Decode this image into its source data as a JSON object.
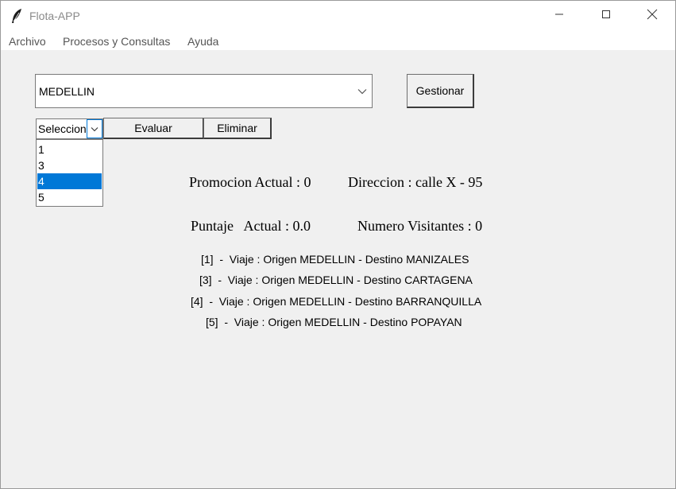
{
  "window": {
    "title": "Flota-APP",
    "icons": {
      "app": "feather-icon",
      "minimize": "minimize-icon",
      "maximize": "maximize-icon",
      "close": "close-icon"
    }
  },
  "menu": {
    "items": [
      "Archivo",
      "Procesos y Consultas",
      "Ayuda"
    ]
  },
  "form": {
    "city_value": "MEDELLIN",
    "gestionar_label": "Gestionar",
    "selector_value": "Seleccione",
    "evaluar_label": "Evaluar",
    "eliminar_label": "Eliminar",
    "dropdown_options": [
      "1",
      "3",
      "4",
      "5"
    ],
    "dropdown_selected": "4"
  },
  "info": {
    "promocion": "Promocion Actual : 0",
    "direccion": "Direccion : calle X - 95",
    "puntaje": "Puntaje   Actual : 0.0",
    "visitantes": "Numero Visitantes : 0"
  },
  "viajes": [
    "[1]  -  Viaje : Origen MEDELLIN - Destino MANIZALES",
    "[3]  -  Viaje : Origen MEDELLIN - Destino CARTAGENA",
    "[4]  -  Viaje : Origen MEDELLIN - Destino BARRANQUILLA",
    "[5]  -  Viaje : Origen MEDELLIN - Destino POPAYAN"
  ],
  "colors": {
    "selection": "#0078d7",
    "window_bg": "#f0f0f0",
    "titlebar_bg": "#ffffff"
  }
}
